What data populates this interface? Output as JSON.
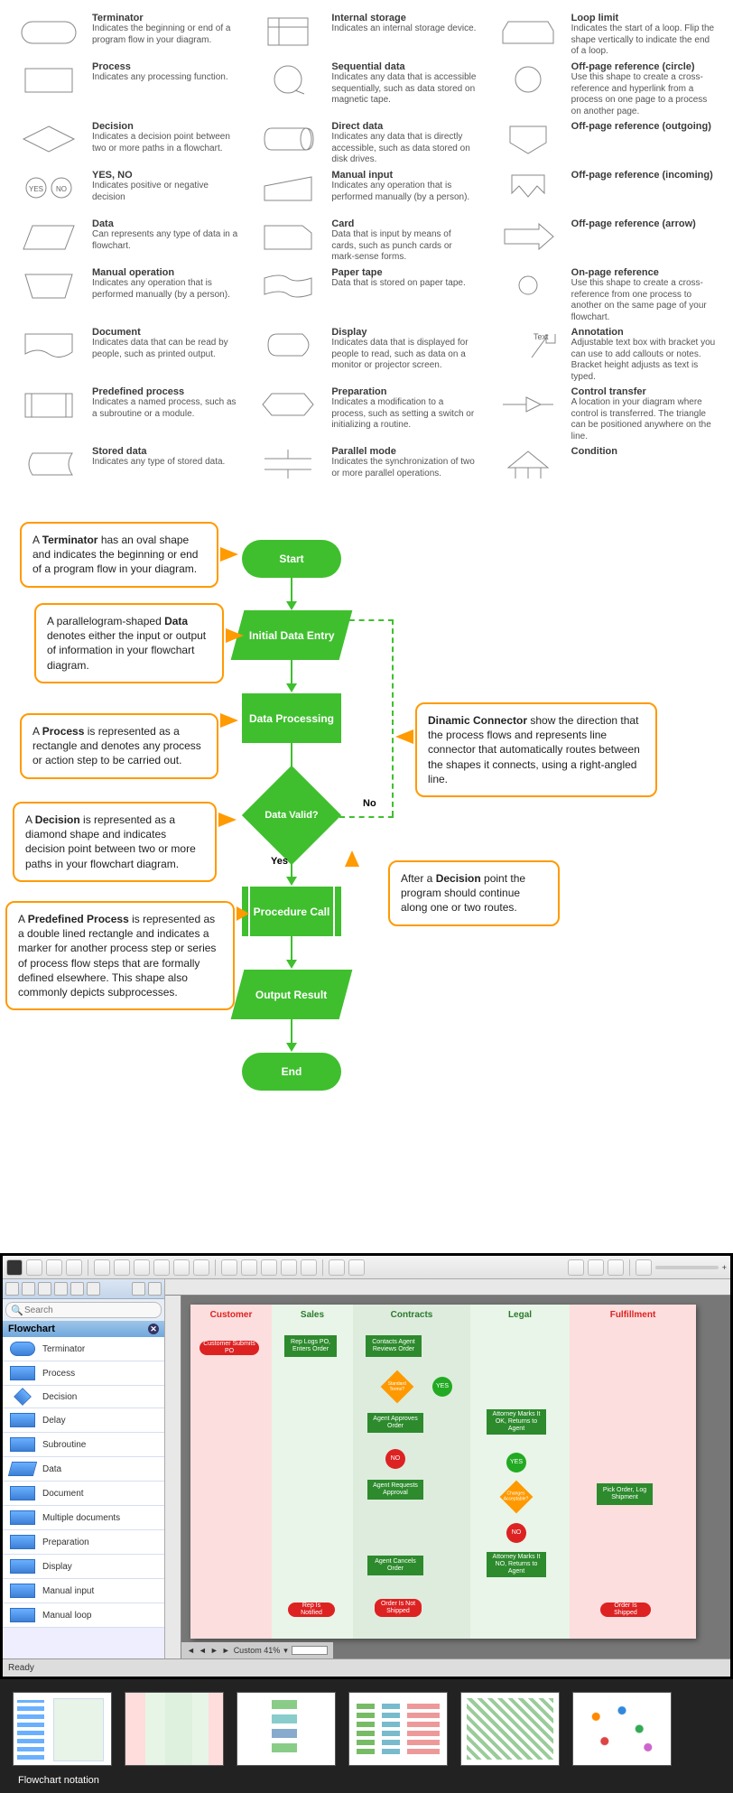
{
  "shapes": [
    {
      "name": "Terminator",
      "desc": "Indicates the beginning or end of a program flow in your diagram."
    },
    {
      "name": "Internal storage",
      "desc": "Indicates an internal storage device."
    },
    {
      "name": "Loop limit",
      "desc": "Indicates the start of a loop. Flip the shape vertically to indicate the end of a loop."
    },
    {
      "name": "Process",
      "desc": "Indicates any processing function."
    },
    {
      "name": "Sequential data",
      "desc": "Indicates any data that is accessible sequentially, such as data stored on magnetic tape."
    },
    {
      "name": "Off-page reference (circle)",
      "desc": "Use this shape to create a cross-reference and hyperlink from a process on one page to a process on another page."
    },
    {
      "name": "Decision",
      "desc": "Indicates a decision point between two or more paths in a flowchart."
    },
    {
      "name": "Direct data",
      "desc": "Indicates any data that is directly accessible, such as data stored on disk drives."
    },
    {
      "name": "Off-page reference (outgoing)",
      "desc": ""
    },
    {
      "name": "YES, NO",
      "desc": "Indicates positive or negative decision"
    },
    {
      "name": "Manual input",
      "desc": "Indicates any operation that is performed manually (by a person)."
    },
    {
      "name": "Off-page reference (incoming)",
      "desc": ""
    },
    {
      "name": "Data",
      "desc": "Can represents any type of data in a flowchart."
    },
    {
      "name": "Card",
      "desc": "Data that is input by means of cards, such as punch cards or mark-sense forms."
    },
    {
      "name": "Off-page reference (arrow)",
      "desc": ""
    },
    {
      "name": "Manual operation",
      "desc": "Indicates any operation that is performed manually (by a person)."
    },
    {
      "name": "Paper tape",
      "desc": "Data that is stored on paper tape."
    },
    {
      "name": "On-page reference",
      "desc": "Use this shape to create a cross-reference from one process to another on the same page of your flowchart."
    },
    {
      "name": "Document",
      "desc": "Indicates data that can be read by people, such as printed output."
    },
    {
      "name": "Display",
      "desc": "Indicates data that is displayed for people to read, such as data on a monitor or projector screen."
    },
    {
      "name": "Annotation",
      "desc": "Adjustable text box with bracket you can use to add callouts or notes. Bracket height adjusts as text is typed.",
      "tag": "Text"
    },
    {
      "name": "Predefined process",
      "desc": "Indicates a named process, such as a subroutine or a module."
    },
    {
      "name": "Preparation",
      "desc": "Indicates a modification to a process, such as setting a switch or initializing a routine."
    },
    {
      "name": "Control transfer",
      "desc": "A location in your diagram where control is transferred. The triangle can be positioned anywhere on the line."
    },
    {
      "name": "Stored data",
      "desc": "Indicates any type of stored data."
    },
    {
      "name": "Parallel mode",
      "desc": "Indicates the synchronization of two or more parallel operations."
    },
    {
      "name": "Condition",
      "desc": ""
    }
  ],
  "callouts": {
    "c1": "A Terminator has an oval shape and indicates the beginning or end of a program flow in your diagram.",
    "c2": "A parallelogram-shaped Data denotes either the input or output of information in your flowchart diagram.",
    "c3": "A Process is represented as a rectangle and denotes any process or action step to be carried out.",
    "c4": "A Decision is represented as a diamond shape and indicates decision point between two or more paths in your flowchart diagram.",
    "c5": "A Predefined Process is represented as a double lined rectangle and indicates a marker for another process step or series of process flow steps that are formally defined elsewhere. This shape also commonly depicts subprocesses.",
    "c6": "Dinamic Connector show the direction that the process flows and represents line connector that automatically routes between the shapes it connects, using a right-angled line.",
    "c7": "After a Decision point the program should continue along one or two routes."
  },
  "flow_nodes": {
    "start": "Start",
    "init": "Initial Data Entry",
    "proc": "Data Processing",
    "valid": "Data Valid?",
    "call": "Procedure Call",
    "out": "Output Result",
    "end": "End",
    "yes": "Yes",
    "no": "No"
  },
  "app": {
    "search_placeholder": "Search",
    "library_title": "Flowchart",
    "lib_items": [
      "Terminator",
      "Process",
      "Decision",
      "Delay",
      "Subroutine",
      "Data",
      "Document",
      "Multiple documents",
      "Preparation",
      "Display",
      "Manual input",
      "Manual loop"
    ],
    "zoom_label": "Custom 41%",
    "status": "Ready",
    "lanes": [
      "Customer",
      "Sales",
      "Contracts",
      "Legal",
      "Fulfillment"
    ],
    "swim": {
      "submit": "Customer Submits PO",
      "replog": "Rep Logs PO, Enters Order",
      "contacts": "Contacts Agent Reviews Order",
      "std": "Standard Terms?",
      "yes": "YES",
      "approves": "Agent Approves Order",
      "attorney1": "Attorney Marks It OK, Returns to Agent",
      "no": "NO",
      "reqapp": "Agent Requests Approval",
      "yes2": "YES",
      "changes": "Changes Acceptable?",
      "pick": "Pick Order, Log Shipment",
      "no2": "NO",
      "cancel": "Agent Cancels Order",
      "attorney2": "Attorney Marks It NO, Returns to Agent",
      "repnot": "Rep Is Notified",
      "notship": "Order Is Not Shipped",
      "shipped": "Order Is Shipped"
    }
  },
  "thumb_caption": "Flowchart notation"
}
